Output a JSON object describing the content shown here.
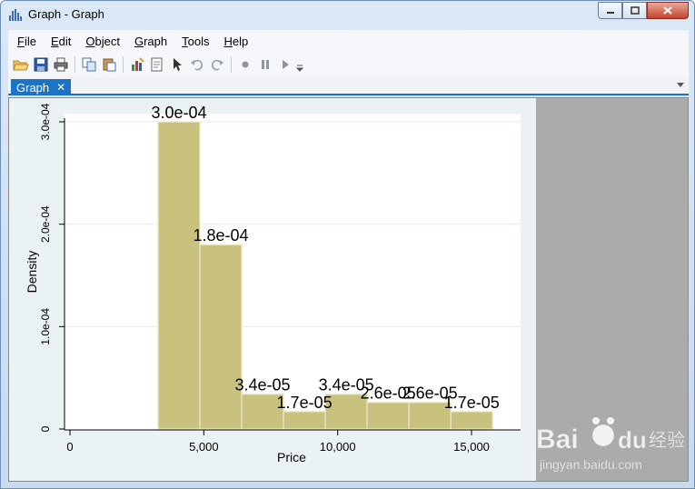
{
  "window": {
    "title": "Graph - Graph"
  },
  "menu": [
    {
      "label": "File",
      "key": "F",
      "rest": "ile"
    },
    {
      "label": "Edit",
      "key": "E",
      "rest": "dit"
    },
    {
      "label": "Object",
      "key": "O",
      "rest": "bject"
    },
    {
      "label": "Graph",
      "key": "G",
      "rest": "raph"
    },
    {
      "label": "Tools",
      "key": "T",
      "rest": "ools"
    },
    {
      "label": "Help",
      "key": "H",
      "rest": "elp"
    }
  ],
  "toolbar_icons": [
    "open-icon",
    "save-icon",
    "print-icon",
    "copy-icon",
    "paste-icon",
    "graph-editor-icon",
    "properties-icon",
    "pointer-icon",
    "undo-icon",
    "redo-icon",
    "record-icon",
    "pause-icon",
    "play-icon"
  ],
  "tab": {
    "label": "Graph",
    "close": "✕"
  },
  "colors": {
    "bar_fill": "#c9c27e",
    "bar_edge": "#eee9c9",
    "tab_blue": "#1a73c7",
    "plot_bg": "#ffffff",
    "graph_bg": "#eaf2f3"
  },
  "chart_data": {
    "type": "bar",
    "xlabel": "Price",
    "ylabel": "Density",
    "xlim": [
      0,
      16000
    ],
    "ylim": [
      0,
      0.0003
    ],
    "x_ticks": [
      {
        "value": 0,
        "label": "0"
      },
      {
        "value": 5000,
        "label": "5,000"
      },
      {
        "value": 10000,
        "label": "10,000"
      },
      {
        "value": 15000,
        "label": "15,000"
      }
    ],
    "y_ticks": [
      {
        "value": 0,
        "label": "0"
      },
      {
        "value": 0.0001,
        "label": "1.0e-04"
      },
      {
        "value": 0.0002,
        "label": "2.0e-04"
      },
      {
        "value": 0.0003,
        "label": "3.0e-04"
      }
    ],
    "bins": [
      {
        "x0": 3291,
        "x1": 4853,
        "value": 0.0003,
        "label": "3.0e-04"
      },
      {
        "x0": 4853,
        "x1": 6415,
        "value": 0.00018,
        "label": "1.8e-04"
      },
      {
        "x0": 6415,
        "x1": 7977,
        "value": 3.4e-05,
        "label": "3.4e-05"
      },
      {
        "x0": 7977,
        "x1": 9539,
        "value": 1.7e-05,
        "label": "1.7e-05"
      },
      {
        "x0": 9539,
        "x1": 11101,
        "value": 3.4e-05,
        "label": "3.4e-05"
      },
      {
        "x0": 11101,
        "x1": 12663,
        "value": 2.6e-05,
        "label": "2.6e-05"
      },
      {
        "x0": 12663,
        "x1": 14225,
        "value": 2.6e-05,
        "label": "2.6e-05"
      },
      {
        "x0": 14225,
        "x1": 15787,
        "value": 1.7e-05,
        "label": "1.7e-05"
      }
    ]
  }
}
